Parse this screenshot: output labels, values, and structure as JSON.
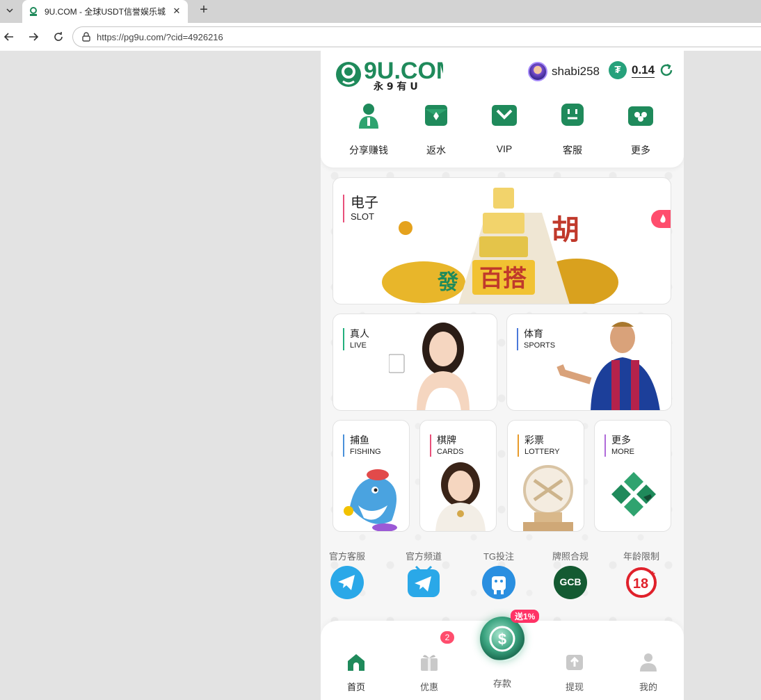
{
  "browser": {
    "tab_title": "9U.COM - 全球USDT信誉娱乐城",
    "url": "https://pg9u.com/?cid=4926216"
  },
  "header": {
    "logo_text": "9U.COM",
    "logo_sub": "永 9 有 U",
    "username": "shabi258",
    "balance": "0.14"
  },
  "quick_menu": [
    {
      "label": "分享赚钱",
      "icon": "share-money-icon"
    },
    {
      "label": "返水",
      "icon": "rebate-envelope-icon"
    },
    {
      "label": "VIP",
      "icon": "vip-icon"
    },
    {
      "label": "客服",
      "icon": "customer-service-icon"
    },
    {
      "label": "更多",
      "icon": "more-cards-icon"
    }
  ],
  "games": {
    "slot": {
      "zh": "电子",
      "en": "SLOT",
      "art_text": "百搭"
    },
    "live": {
      "zh": "真人",
      "en": "LIVE"
    },
    "sports": {
      "zh": "体育",
      "en": "SPORTS"
    },
    "fishing": {
      "zh": "捕鱼",
      "en": "FISHING"
    },
    "cards": {
      "zh": "棋牌",
      "en": "CARDS"
    },
    "lottery": {
      "zh": "彩票",
      "en": "LOTTERY"
    },
    "more": {
      "zh": "更多",
      "en": "MORE"
    }
  },
  "social": [
    {
      "label": "官方客服",
      "icon": "telegram-icon"
    },
    {
      "label": "官方频道",
      "icon": "telegram-channel-icon"
    },
    {
      "label": "TG投注",
      "icon": "android-bot-icon"
    },
    {
      "label": "牌照合规",
      "icon": "gcb-license-icon",
      "badge_text": "GCB"
    },
    {
      "label": "年龄限制",
      "icon": "age-18-icon",
      "badge_text": "18"
    }
  ],
  "bottom_nav": {
    "home": "首页",
    "promo": "优惠",
    "promo_badge": "2",
    "deposit": "存款",
    "deposit_tag": "送1%",
    "withdraw": "提现",
    "mine": "我的"
  },
  "colors": {
    "brand_green": "#1f8a5b",
    "accent_pink": "#e8507a",
    "badge_red": "#ff4d6d"
  }
}
